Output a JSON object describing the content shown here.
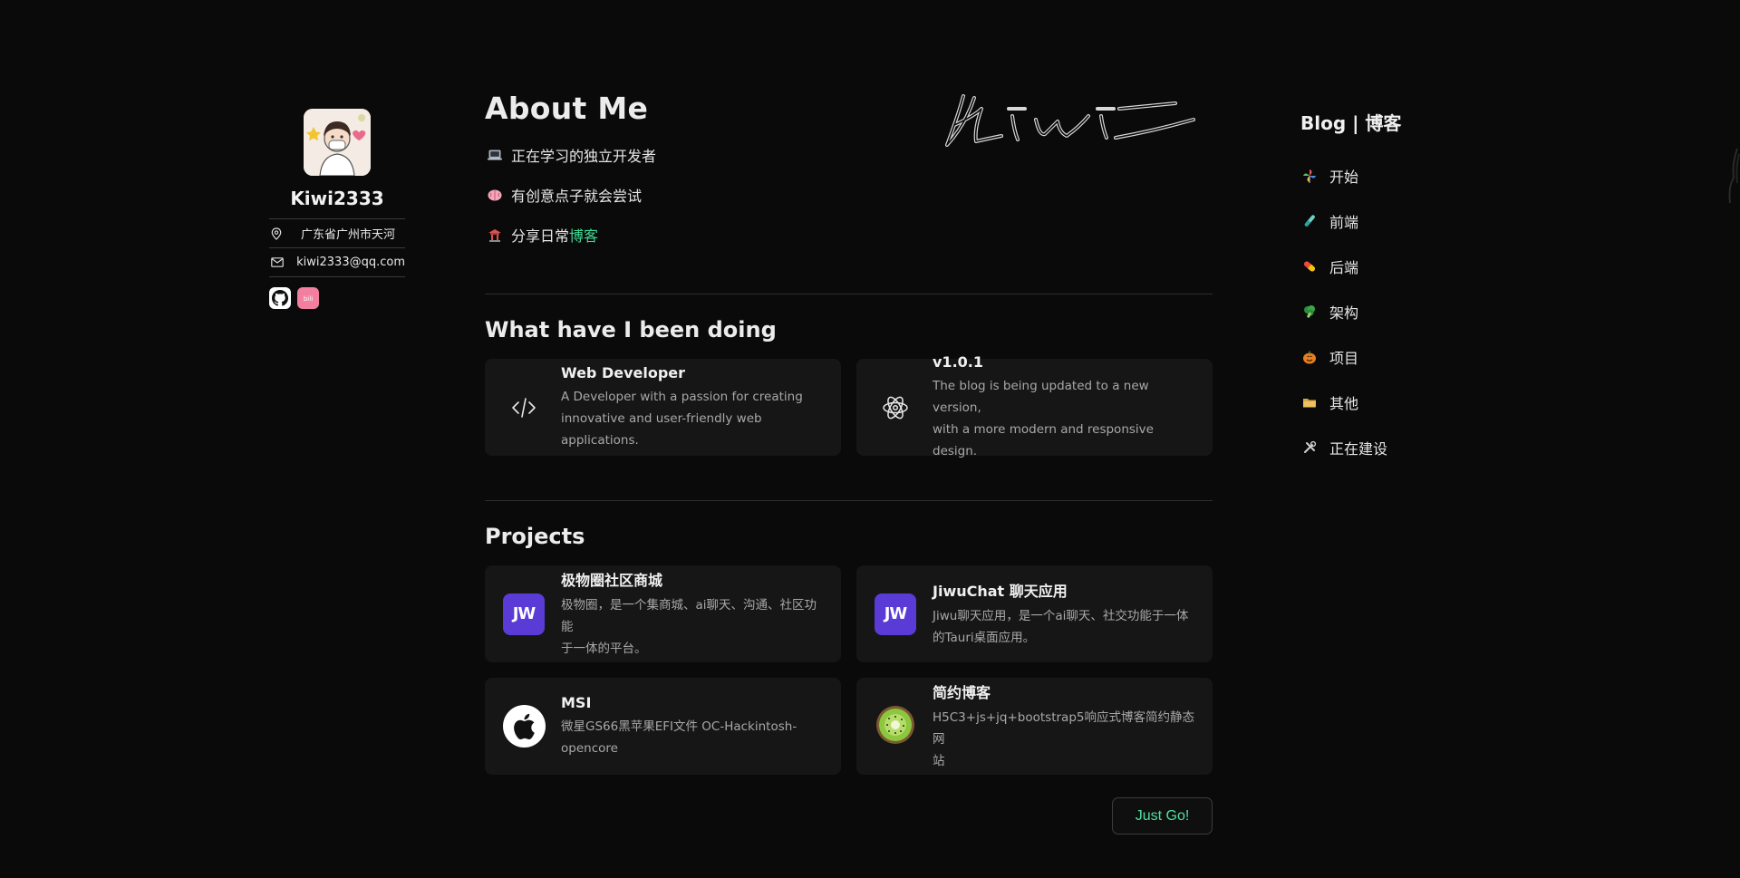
{
  "profile": {
    "name": "Kiwi2333",
    "location": "广东省广州市天河",
    "email": "kiwi2333@qq.com",
    "socials": [
      {
        "name": "github",
        "icon": "github-icon"
      },
      {
        "name": "bilibili",
        "icon": "bilibili-icon"
      }
    ]
  },
  "about": {
    "title": "About Me",
    "lines": [
      {
        "icon": "laptop-icon",
        "text": "正在学习的独立开发者"
      },
      {
        "icon": "brain-icon",
        "text": "有创意点子就会尝试"
      },
      {
        "icon": "temple-icon",
        "text": "分享日常",
        "link": "博客"
      }
    ]
  },
  "doing": {
    "title": "What have I been doing",
    "cards": [
      {
        "icon": "code-icon",
        "title": "Web Developer",
        "desc1": "A Developer with a passion for creating",
        "desc2": "innovative and user-friendly web applications."
      },
      {
        "icon": "atom-icon",
        "title": "v1.0.1",
        "desc1": "The blog is being updated to a new version,",
        "desc2": "with a more modern and responsive design."
      }
    ]
  },
  "projects": {
    "title": "Projects",
    "items": [
      {
        "logo": "JW",
        "title": "极物圈社区商城",
        "desc1": "极物圈，是一个集商城、ai聊天、沟通、社区功能",
        "desc2": "于一体的平台。"
      },
      {
        "logo": "JW",
        "title": "JiwuChat 聊天应用",
        "desc1": "Jiwu聊天应用，是一个ai聊天、社交功能于一体",
        "desc2": "的Tauri桌面应用。"
      },
      {
        "logo": "apple",
        "title": "MSI",
        "desc1": "微星GS66黑苹果EFI文件 OC-Hackintosh-",
        "desc2": "opencore"
      },
      {
        "logo": "kiwi",
        "title": "简约博客",
        "desc1": "H5C3+js+jq+bootstrap5响应式博客简约静态网",
        "desc2": "站"
      }
    ],
    "cta": "Just Go!"
  },
  "blog_nav": {
    "title": "Blog | 博客",
    "items": [
      {
        "icon": "pinwheel-icon",
        "label": "开始"
      },
      {
        "icon": "test-tube-icon",
        "label": "前端"
      },
      {
        "icon": "pill-icon",
        "label": "后端"
      },
      {
        "icon": "broccoli-icon",
        "label": "架构"
      },
      {
        "icon": "pumpkin-icon",
        "label": "项目"
      },
      {
        "icon": "folder-icon",
        "label": "其他"
      },
      {
        "icon": "tools-icon",
        "label": "正在建设"
      }
    ]
  },
  "colors": {
    "background": "#0a0a0a",
    "card": "#161616",
    "accent": "#3ddc97",
    "project_logo": "#5a3bd6"
  }
}
